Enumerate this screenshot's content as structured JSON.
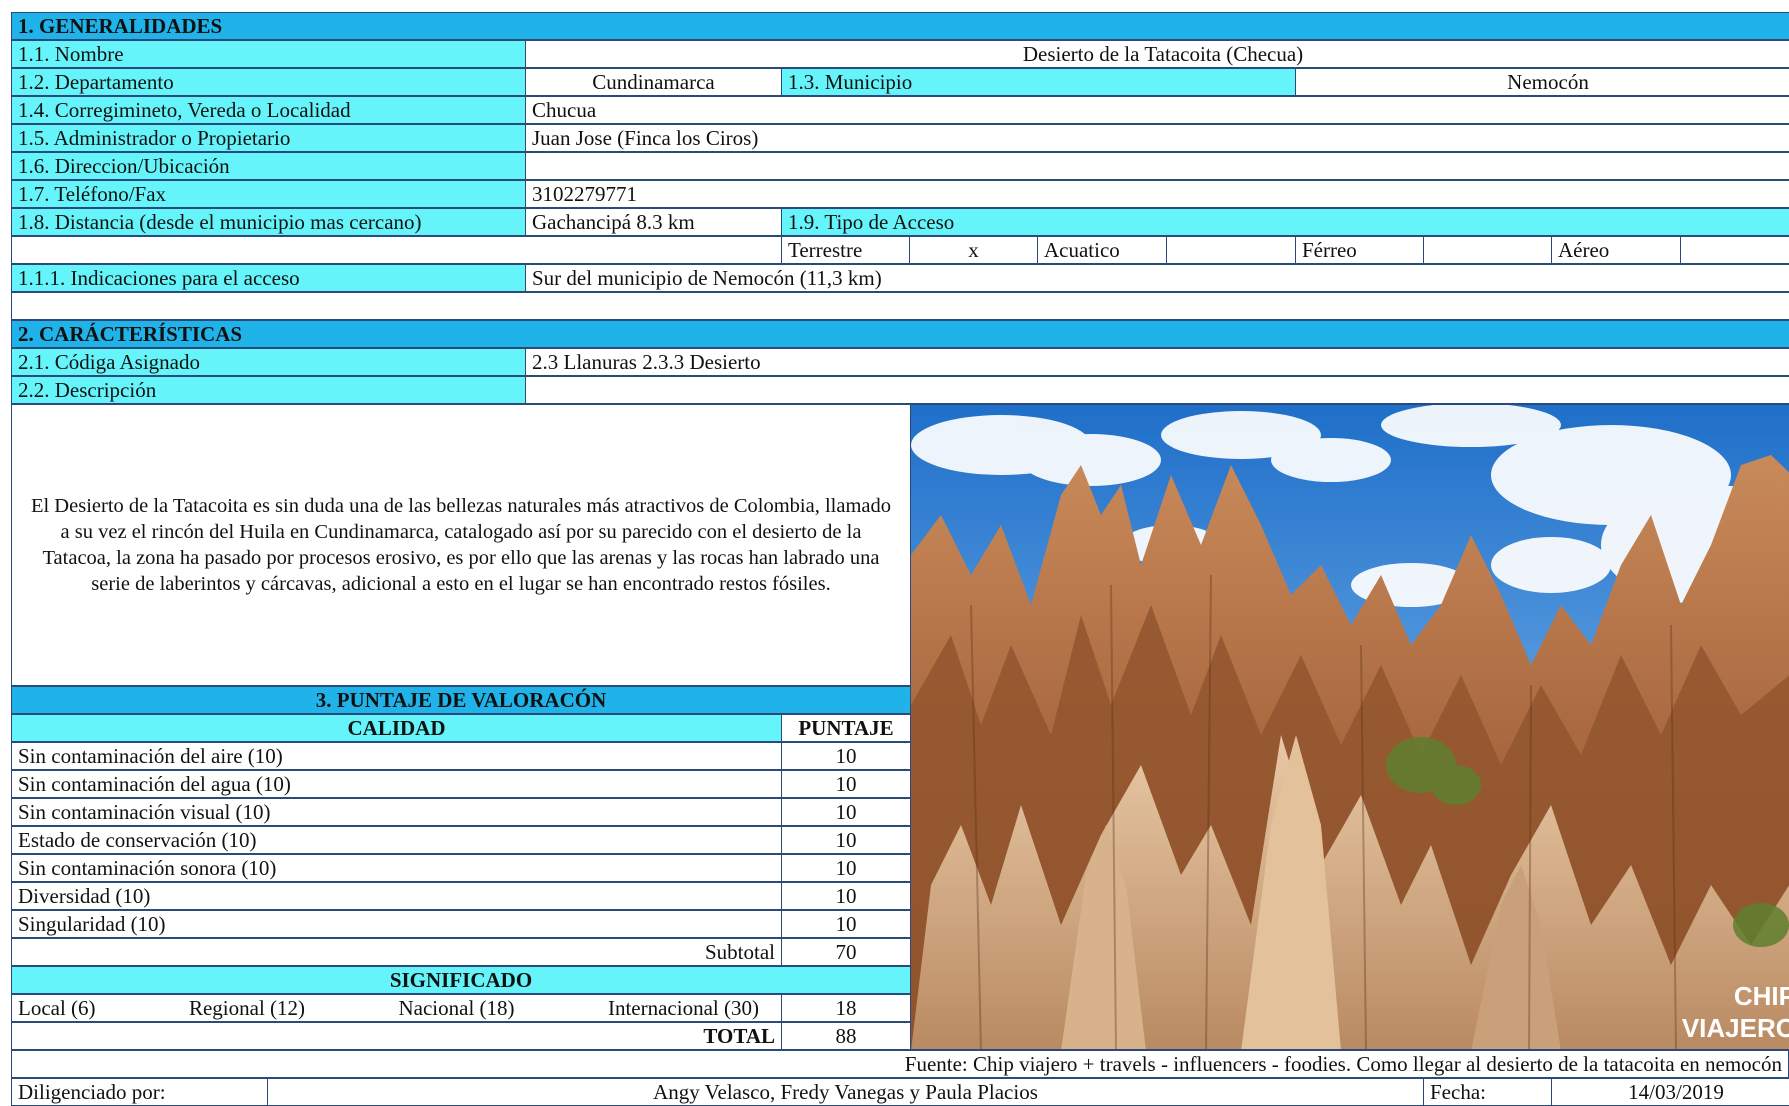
{
  "s1": {
    "header": "1. GENERALIDADES",
    "nombre_label": "1.1. Nombre",
    "nombre": "Desierto de la Tatacoita (Checua)",
    "departamento_label": "1.2. Departamento",
    "departamento": "Cundinamarca",
    "municipio_label": "1.3. Municipio",
    "municipio": "Nemocón",
    "corregimiento_label": "1.4. Corregimineto, Vereda o Localidad",
    "corregimiento": "Chucua",
    "administrador_label": "1.5. Administrador o Propietario",
    "administrador": "Juan Jose (Finca los Ciros)",
    "direccion_label": "1.6. Direccion/Ubicación",
    "direccion": "",
    "telefono_label": "1.7. Teléfono/Fax",
    "telefono": "3102279771",
    "distancia_label": "1.8. Distancia (desde el municipio mas cercano)",
    "distancia": "Gachancipá 8.3 km",
    "acceso_label": "1.9. Tipo de Acceso",
    "acceso_tipos": [
      {
        "label": "Terrestre",
        "mark": "x"
      },
      {
        "label": "Acuatico",
        "mark": ""
      },
      {
        "label": "Férreo",
        "mark": ""
      },
      {
        "label": "Aéreo",
        "mark": ""
      }
    ],
    "indicaciones_label": "1.1.1. Indicaciones para el acceso",
    "indicaciones": "Sur del municipio de Nemocón (11,3 km)"
  },
  "s2": {
    "header": "2. CARÁCTERÍSTICAS",
    "codigo_label": "2.1. Códiga Asignado",
    "codigo": "2.3 Llanuras   2.3.3 Desierto",
    "descripcion_label": "2.2. Descripción",
    "descripcion": "El Desierto de la Tatacoita es sin duda una de las bellezas naturales más atractivos de Colombia, llamado a su vez el rincón del Huila en Cundinamarca, catalogado así por su parecido con el desierto de la Tatacoa, la zona ha pasado por procesos erosivo, es por ello que las arenas y las rocas han labrado una serie de laberintos y cárcavas, adicional a esto en el lugar se han encontrado restos fósiles."
  },
  "s3": {
    "header": "3. PUNTAJE DE VALORACÓN",
    "calidad_label": "CALIDAD",
    "puntaje_label": "PUNTAJE",
    "rows": [
      {
        "label": "Sin contaminación del aire (10)",
        "score": "10"
      },
      {
        "label": "Sin contaminación del agua (10)",
        "score": "10"
      },
      {
        "label": "Sin contaminación visual (10)",
        "score": "10"
      },
      {
        "label": "Estado de conservación (10)",
        "score": "10"
      },
      {
        "label": "Sin contaminación sonora (10)",
        "score": "10"
      },
      {
        "label": "Diversidad (10)",
        "score": "10"
      },
      {
        "label": "Singularidad (10)",
        "score": "10"
      }
    ],
    "subtotal_label": "Subtotal",
    "subtotal": "70",
    "significado_label": "SIGNIFICADO",
    "significado_opts": [
      "Local (6)",
      "Regional (12)",
      "Nacional (18)",
      "Internacional (30)"
    ],
    "significado": "18",
    "total_label": "TOTAL",
    "total": "88"
  },
  "photo": {
    "watermark": "CHIP VIAJERO"
  },
  "footer": {
    "fuente": "Fuente: Chip viajero + travels - influencers - foodies. Como llegar al desierto de la tatacoita en nemocón",
    "diligenciado_label": "Diligenciado por:",
    "diligenciado": "Angy Velasco, Fredy Vanegas y Paula Placios",
    "fecha_label": "Fecha:",
    "fecha": "14/03/2019"
  }
}
